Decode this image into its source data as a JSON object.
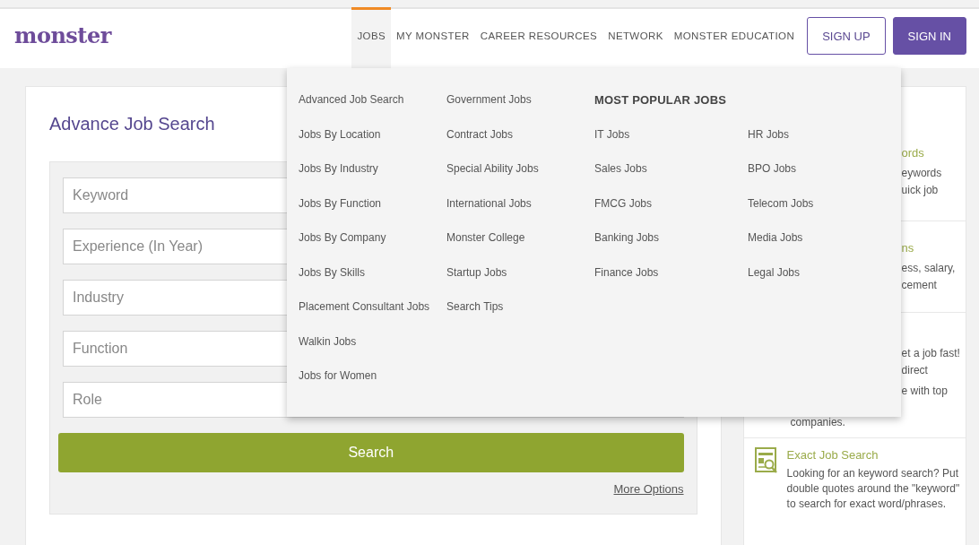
{
  "header": {
    "logo": "monster",
    "nav": [
      {
        "label": "JOBS",
        "selected": true
      },
      {
        "label": "MY MONSTER",
        "selected": false
      },
      {
        "label": "CAREER RESOURCES",
        "selected": false
      },
      {
        "label": "NETWORK",
        "selected": false
      },
      {
        "label": "MONSTER EDUCATION",
        "selected": false
      }
    ],
    "buttons": [
      {
        "label": "SIGN UP",
        "kind": "outline"
      },
      {
        "label": "SIGN IN",
        "kind": "filled"
      }
    ]
  },
  "search_panel": {
    "title": "Advance Job Search",
    "fields": [
      {
        "placeholder": "Keyword"
      },
      {
        "placeholder": "Experience (In Year)"
      },
      {
        "placeholder": "Industry"
      },
      {
        "placeholder": "Function"
      },
      {
        "placeholder": "Role"
      }
    ],
    "search_button": "Search",
    "more_options": "More Options"
  },
  "sidebar": {
    "cards": [
      {
        "title": "ords",
        "covered": true,
        "paragraphs": [
          [
            "eywords",
            "uick job"
          ]
        ]
      },
      {
        "title": "ns",
        "covered": true,
        "paragraphs": [
          [
            "ess, salary,",
            "cement"
          ]
        ]
      },
      {
        "covered": true,
        "paragraphs": [
          [
            "et a job fast!",
            "direct"
          ],
          [
            "e with top"
          ]
        ],
        "tail": "companies."
      },
      {
        "title": "Exact Job Search",
        "covered": false,
        "paragraphs": [
          [
            "Looking for an keyword search? Put double quotes around the \"keyword\" to search for exact word/phrases."
          ]
        ]
      }
    ]
  },
  "dropdown": {
    "columns": [
      {
        "items": [
          "Advanced Job Search",
          "Jobs By Location",
          "Jobs By Industry",
          "Jobs By Function",
          "Jobs By Company",
          "Jobs By Skills",
          "Placement Consultant Jobs",
          "Walkin Jobs",
          "Jobs for Women"
        ]
      },
      {
        "items": [
          "Government Jobs",
          "Contract Jobs",
          "Special Ability Jobs",
          "International Jobs",
          "Monster College",
          "Startup Jobs",
          "Search Tips"
        ]
      }
    ],
    "popular": {
      "heading": "MOST POPULAR JOBS",
      "columns": [
        [
          "IT Jobs",
          "Sales Jobs",
          "FMCG Jobs",
          "Banking Jobs",
          "Finance Jobs"
        ],
        [
          "HR Jobs",
          "BPO Jobs",
          "Telecom Jobs",
          "Media Jobs",
          "Legal Jobs"
        ]
      ]
    }
  }
}
